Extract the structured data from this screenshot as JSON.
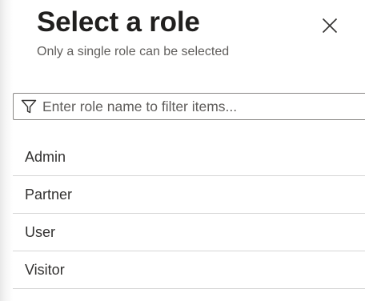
{
  "dialog": {
    "title": "Select a role",
    "subtitle": "Only a single role can be selected",
    "close_icon": "close-icon"
  },
  "filter": {
    "placeholder": "Enter role name to filter items...",
    "value": "",
    "icon": "filter-icon"
  },
  "roles": [
    {
      "label": "Admin"
    },
    {
      "label": "Partner"
    },
    {
      "label": "User"
    },
    {
      "label": "Visitor"
    }
  ]
}
